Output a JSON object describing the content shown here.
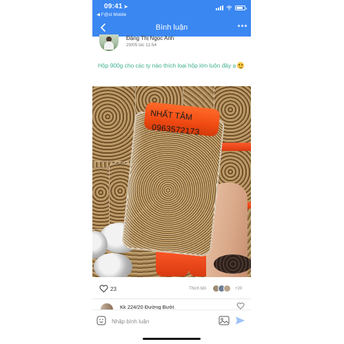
{
  "status_bar": {
    "time": "09:41",
    "carrier": "◀ F@st Mobile"
  },
  "nav": {
    "title": "Bình luận"
  },
  "post": {
    "author": "Đặng Thị Ngọc Anh",
    "timestamp": "20/05 lúc 11:54",
    "caption": "Hộp 900g cho các ty nào thích loại hộp lớn luôn đây ạ",
    "caption_emoji": "smile-emoji",
    "photo": {
      "label_text": "NHẤT TÂM",
      "phone_text": "0963572173"
    }
  },
  "reactions": {
    "likes_count": "23",
    "liked_by_label": "Thích bởi",
    "more_count": "+20"
  },
  "comment": {
    "author": "Kk 224/20 Đường Bưởi"
  },
  "composer": {
    "placeholder": "Nhập bình luận"
  },
  "colors": {
    "header_blue": "#3a87f2",
    "caption_green": "#3cae8e",
    "send_blue": "#9dc3f6"
  }
}
